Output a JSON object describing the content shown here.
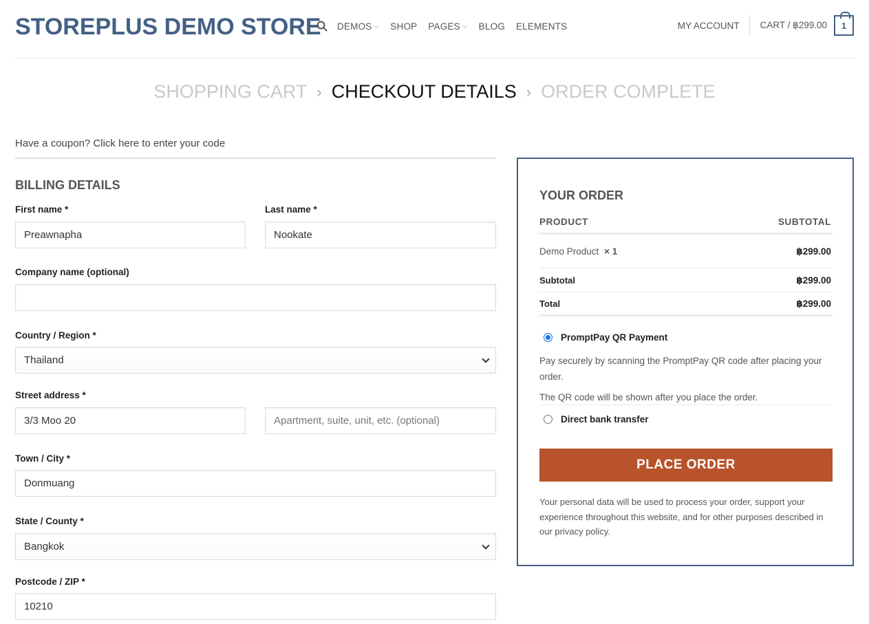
{
  "header": {
    "logo": "STOREPLUS DEMO STORE",
    "nav": [
      {
        "label": "DEMOS",
        "dropdown": true
      },
      {
        "label": "SHOP",
        "dropdown": false
      },
      {
        "label": "PAGES",
        "dropdown": true
      },
      {
        "label": "BLOG",
        "dropdown": false
      },
      {
        "label": "ELEMENTS",
        "dropdown": false
      }
    ],
    "account": "MY ACCOUNT",
    "cart_label": "CART / ฿299.00",
    "cart_count": "1"
  },
  "steps": {
    "cart": "SHOPPING CART",
    "sep1": "›",
    "checkout": "CHECKOUT DETAILS",
    "sep2": "›",
    "complete": "ORDER COMPLETE"
  },
  "coupon": "Have a coupon? Click here to enter your code",
  "billing": {
    "title": "BILLING DETAILS",
    "first_name_label": "First name *",
    "first_name": "Preawnapha",
    "last_name_label": "Last name *",
    "last_name": "Nookate",
    "company_label": "Company name (optional)",
    "company": "",
    "country_label": "Country / Region *",
    "country": "Thailand",
    "street_label": "Street address *",
    "street": "3/3 Moo 20",
    "apartment_placeholder": "Apartment, suite, unit, etc. (optional)",
    "city_label": "Town / City *",
    "city": "Donmuang",
    "state_label": "State / County *",
    "state": "Bangkok",
    "postcode_label": "Postcode / ZIP *",
    "postcode": "10210"
  },
  "order": {
    "title": "YOUR ORDER",
    "col_product": "PRODUCT",
    "col_subtotal": "SUBTOTAL",
    "item_name": "Demo Product",
    "item_qty": "× 1",
    "item_price": "฿299.00",
    "subtotal_label": "Subtotal",
    "subtotal": "฿299.00",
    "total_label": "Total",
    "total": "฿299.00",
    "payment_1": "PromptPay QR Payment",
    "payment_1_desc": "Pay securely by scanning the PromptPay QR code after placing your order.",
    "payment_1_note": "The QR code will be shown after you place the order.",
    "payment_2": "Direct bank transfer",
    "place_order": "PLACE ORDER",
    "privacy": "Your personal data will be used to process your order, support your experience throughout this website, and for other purposes described in our privacy policy."
  },
  "colors": {
    "brand": "#446084",
    "button": "#b8532a"
  }
}
